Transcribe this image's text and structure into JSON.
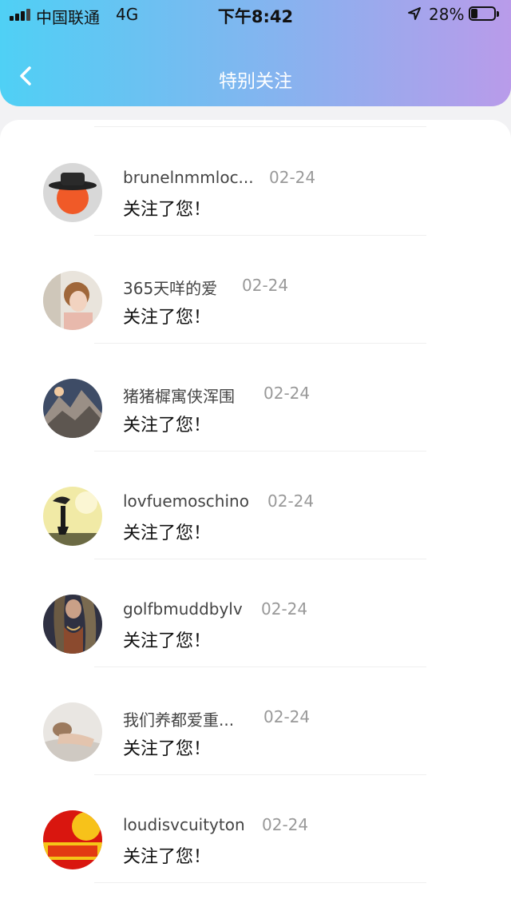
{
  "status_bar": {
    "carrier": "中国联通",
    "network": "4G",
    "time": "下午8:42",
    "battery_percent": "28%",
    "battery_level": 0.28
  },
  "header": {
    "title": "特别关注",
    "back_icon": "chevron-left-icon"
  },
  "notifications": [
    {
      "name": "brunelnmmloc...",
      "date": "02-24",
      "message": "关注了您！"
    },
    {
      "name": "365天咩的爱",
      "date": "02-24",
      "message": "关注了您！"
    },
    {
      "name": "猪猪樨寓侠浑围",
      "date": "02-24",
      "message": "关注了您！"
    },
    {
      "name": "lovfuemoschino",
      "date": "02-24",
      "message": "关注了您！"
    },
    {
      "name": "golfbmuddbylv",
      "date": "02-24",
      "message": "关注了您！"
    },
    {
      "name": "我们养都爱重...",
      "date": "02-24",
      "message": "关注了您！"
    },
    {
      "name": "loudisvcuityton",
      "date": "02-24",
      "message": "关注了您！"
    }
  ]
}
